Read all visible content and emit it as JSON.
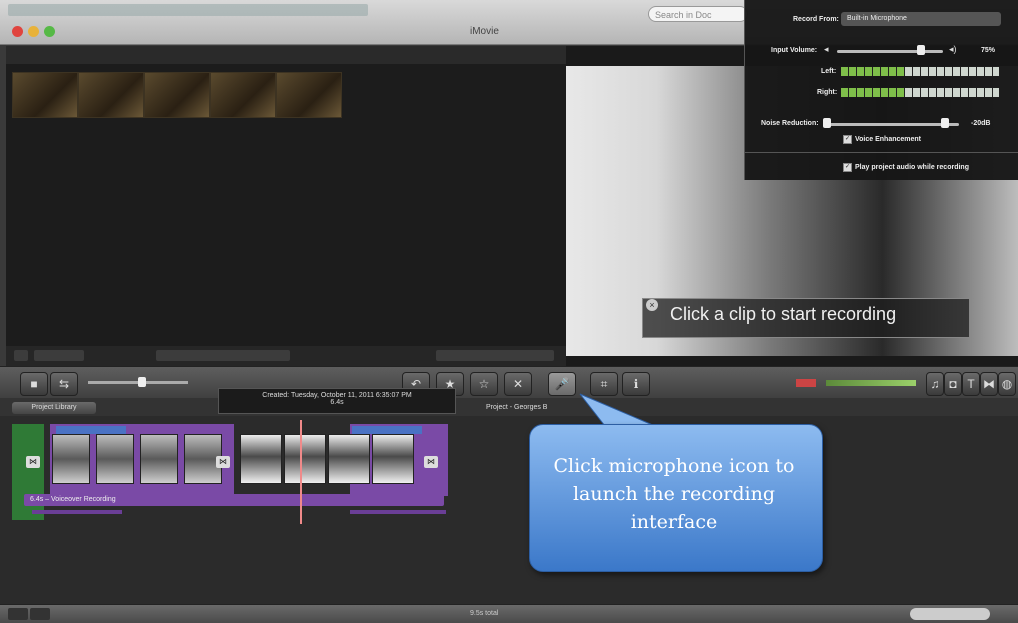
{
  "window": {
    "title": "iMovie"
  },
  "search": {
    "placeholder": "Search in Doc"
  },
  "viewer": {
    "overlay_text": "Click a clip to start recording"
  },
  "record_panel": {
    "record_from_label": "Record From:",
    "record_from_value": "Built-in Microphone",
    "input_volume_label": "Input Volume:",
    "input_volume_value": "75%",
    "left_label": "Left:",
    "right_label": "Right:",
    "noise_reduction_label": "Noise Reduction:",
    "noise_reduction_value": "-20dB",
    "voice_enhancement_label": "Voice Enhancement",
    "play_audio_label": "Play project audio while recording"
  },
  "project": {
    "library_button": "Project Library",
    "title": "Project - Georges B",
    "tooltip_line1": "Created: Tuesday, October 11, 2011 6:35:07 PM",
    "tooltip_line2": "6.4s",
    "voiceover_label": "6.4s – Voiceover Recording"
  },
  "callout": {
    "text": "Click microphone icon to launch the recording interface"
  },
  "status": {
    "total": "9.5s total"
  },
  "colors": {
    "callout": "#5b93dd",
    "voiceover": "#7a4aa6",
    "meter_green": "#7fbf4a"
  }
}
